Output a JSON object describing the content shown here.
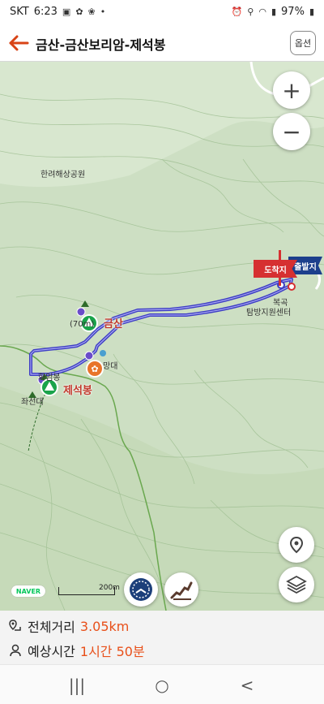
{
  "status_bar": {
    "carrier": "SKT",
    "time": "6:23",
    "battery": "97%",
    "icons_left": [
      "image-icon",
      "app-icon",
      "app-icon",
      "dot-icon"
    ],
    "icons_right": [
      "alarm-icon",
      "location-icon",
      "wifi-icon",
      "signal-icon",
      "battery-icon"
    ]
  },
  "header": {
    "back_icon": "arrow-left-icon",
    "title": "금산-금산보리암-제석봉",
    "options_label": "옵션"
  },
  "map": {
    "labels": {
      "park": "한려해상공원",
      "geumsan": "금산",
      "geumsan_elev": "(70",
      "elev_suffix": "m)",
      "jeseokbong": "제석봉",
      "hwaeombong": "화엄봉",
      "jwaseondae": "좌선대",
      "mangdae": "망대",
      "bokgok": "복곡",
      "bokgok_center": "탐방지원센터",
      "end_flag": "도착지",
      "start_flag": "출발지"
    },
    "zoom_in": "+",
    "zoom_out": "−",
    "naver": "NAVER",
    "scale": "200m",
    "route_color": "#3d3dc4",
    "accent": "#e8501a"
  },
  "info": {
    "distance_label": "전체거리",
    "distance_value": "3.05km",
    "time_label": "예상시간",
    "time_value": "1시간 50분"
  },
  "nav": {
    "recent": "|||",
    "home": "○",
    "back": "<"
  }
}
